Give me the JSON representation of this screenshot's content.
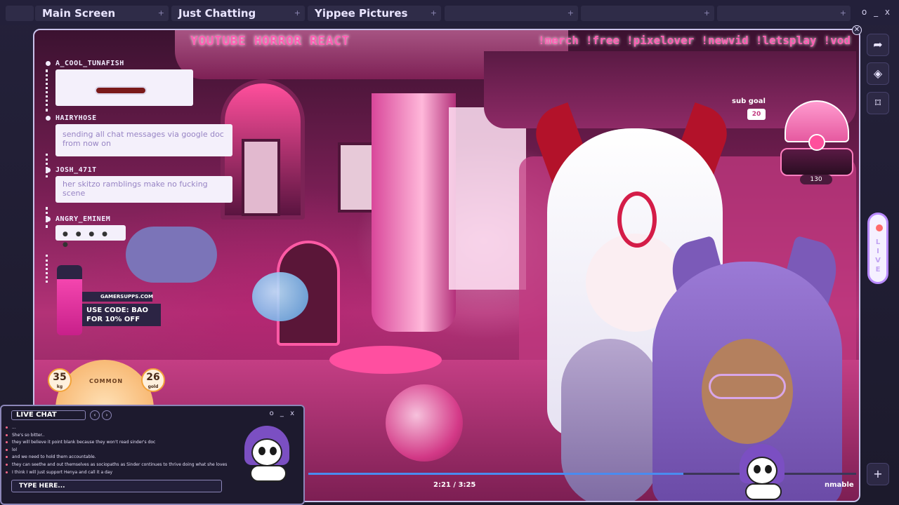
{
  "tabs": [
    {
      "label": "Main Screen"
    },
    {
      "label": "Just Chatting"
    },
    {
      "label": "Yippee Pictures"
    },
    {
      "label": ""
    },
    {
      "label": ""
    },
    {
      "label": ""
    }
  ],
  "window_controls": "o _ x",
  "stream": {
    "title": "YOUTUBE HORROR REACT",
    "commands": [
      "!merch",
      "!free",
      "!pixelover",
      "!newvid",
      "!letsplay",
      "!vod"
    ]
  },
  "overlay_chat": [
    {
      "user": "A_COOL_TUNAFISH",
      "text": ""
    },
    {
      "user": "HAIRYHOSE",
      "text": "sending all chat messages via google doc from now on"
    },
    {
      "user": "JOSH_471T",
      "text": "her skitzo ramblings make no fucking scene"
    },
    {
      "user": "ANGRY_EMINEM",
      "text": ""
    }
  ],
  "sponsor": {
    "site": "GAMERSUPPS.COM",
    "code_line1": "USE CODE: BAO",
    "code_line2": "FOR 10% OFF"
  },
  "stats": {
    "kg_value": "35",
    "kg_unit": "kg",
    "gold_value": "26",
    "gold_unit": "gold",
    "rarity": "COMMON"
  },
  "sub_goal": {
    "label": "sub goal",
    "target": "20",
    "count": "130"
  },
  "player": {
    "time": "2:21 / 3:25",
    "progress": 0.685,
    "suffix": "nmable"
  },
  "live": {
    "label": "LIVE",
    "letters": [
      "L",
      "I",
      "V",
      "E"
    ]
  },
  "side_icons": [
    "share-icon",
    "sticker-icon",
    "bookmark-icon",
    "plus-icon"
  ],
  "live_chat": {
    "title": "LIVE CHAT",
    "controls": "o _ x",
    "input_placeholder": "TYPE HERE...",
    "messages": [
      {
        "user": "",
        "text": "..."
      },
      {
        "user": "",
        "text": "She's so bitter.."
      },
      {
        "user": "",
        "text": "they will believe it point blank because they won't read sinder's doc"
      },
      {
        "user": "",
        "text": "lol"
      },
      {
        "user": "",
        "text": "and we need to hold them accountable."
      },
      {
        "user": "",
        "text": "they can seethe and out themselves as sociopaths as Sinder continues to thrive doing what she loves"
      },
      {
        "user": "",
        "text": "I think I will just support Henya and call it a day"
      }
    ]
  },
  "colors": {
    "accent_pink": "#ff5fb4",
    "frame_border": "#c8c2ea",
    "progress": "#4a8bf0",
    "live_purple": "#b98aff"
  }
}
